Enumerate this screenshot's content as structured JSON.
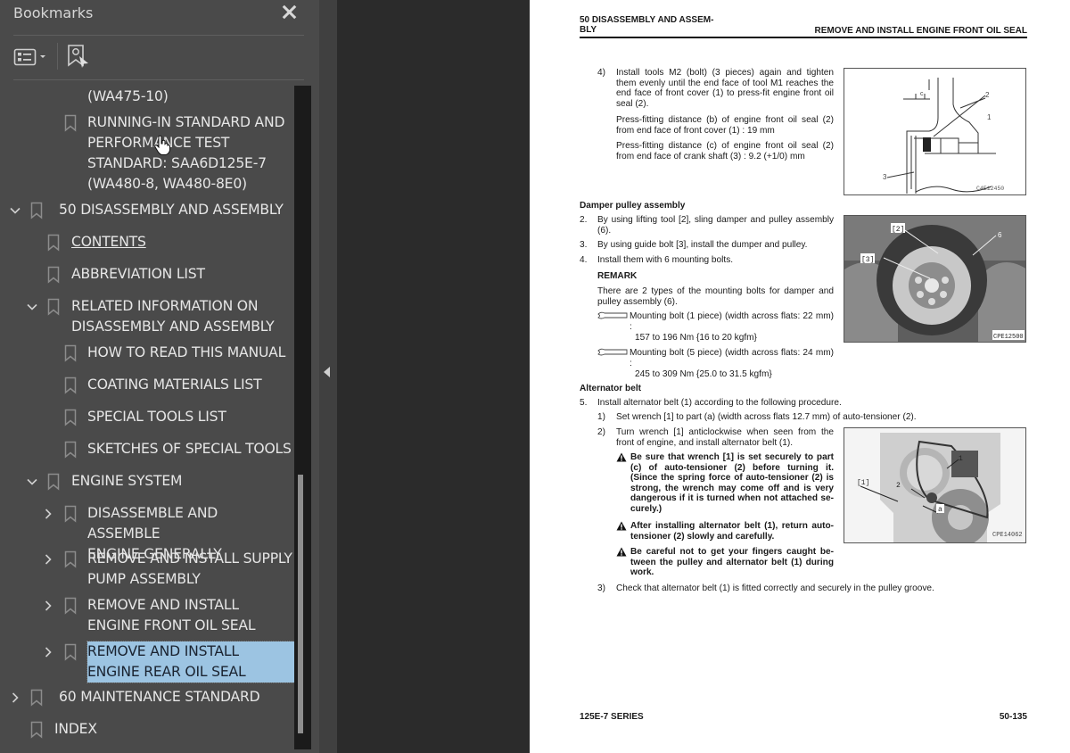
{
  "sidebar": {
    "title": "Bookmarks",
    "close_icon": "close-icon",
    "toolbar": {
      "options_icon": "list-options-icon",
      "find_icon": "find-bookmark-icon"
    },
    "items": [
      {
        "label": "(WA475-10)",
        "level": 2,
        "expander": "none",
        "has_bookmark_icon": false
      },
      {
        "label": " RUNNING-IN STANDARD AND\nPERFORMANCE TEST\nSTANDARD: SAA6D125E-7\n(WA480-8, WA480-8E0)",
        "level": 2,
        "expander": "none",
        "has_bookmark_icon": true
      },
      {
        "label": "50 DISASSEMBLY AND ASSEMBLY",
        "level": 0,
        "expander": "expanded",
        "has_bookmark_icon": true
      },
      {
        "label": " CONTENTS",
        "level": 1,
        "expander": "none",
        "has_bookmark_icon": true,
        "underlined": true
      },
      {
        "label": " ABBREVIATION LIST",
        "level": 1,
        "expander": "none",
        "has_bookmark_icon": true
      },
      {
        "label": " RELATED INFORMATION ON\nDISASSEMBLY AND ASSEMBLY",
        "level": 1,
        "expander": "expanded",
        "has_bookmark_icon": true
      },
      {
        "label": " HOW TO READ THIS MANUAL",
        "level": 2,
        "expander": "none",
        "has_bookmark_icon": true
      },
      {
        "label": " COATING MATERIALS LIST",
        "level": 2,
        "expander": "none",
        "has_bookmark_icon": true
      },
      {
        "label": " SPECIAL TOOLS LIST",
        "level": 2,
        "expander": "none",
        "has_bookmark_icon": true
      },
      {
        "label": " SKETCHES OF SPECIAL TOOLS",
        "level": 2,
        "expander": "none",
        "has_bookmark_icon": true
      },
      {
        "label": " ENGINE SYSTEM",
        "level": 1,
        "expander": "expanded",
        "has_bookmark_icon": true
      },
      {
        "label": " DISASSEMBLE AND ASSEMBLE\nENGINE GENERALLY",
        "level": 2,
        "expander": "collapsed",
        "has_bookmark_icon": true
      },
      {
        "label": " REMOVE AND INSTALL SUPPLY\nPUMP ASSEMBLY",
        "level": 2,
        "expander": "collapsed",
        "has_bookmark_icon": true
      },
      {
        "label": " REMOVE AND INSTALL\nENGINE FRONT OIL SEAL",
        "level": 2,
        "expander": "collapsed",
        "has_bookmark_icon": true
      },
      {
        "label": " REMOVE AND INSTALL\nENGINE REAR OIL SEAL",
        "level": 2,
        "expander": "collapsed",
        "has_bookmark_icon": true,
        "selected": true
      },
      {
        "label": "60 MAINTENANCE STANDARD",
        "level": 0,
        "expander": "collapsed",
        "has_bookmark_icon": true
      },
      {
        "label": "INDEX",
        "level": 0,
        "expander": "none",
        "has_bookmark_icon": true
      }
    ]
  },
  "colors": {
    "sidebar_bg": "#4a4a4a",
    "viewer_bg": "#2b2b2b",
    "selection": "#9cc4e2",
    "text": "#e6e6e6"
  },
  "page": {
    "header_left": "50 DISASSEMBLY AND ASSEM-\nBLY",
    "header_right": "REMOVE AND INSTALL ENGINE FRONT OIL SEAL",
    "step4_num": "4)",
    "step4_text": "Install tools M2 (bolt) (3 pieces) again and tighten them evenly until the end face of tool M1 reaches the end face of front cover (1) to press-fit engine front oil seal (2).",
    "step4_b": "Press-fitting distance (b) of engine front oil seal (2) from end face of front cover (1) : 19 mm",
    "step4_c": "Press-fitting distance (c) of engine front oil seal (2) from end face of crank shaft (3) : 9.2 (+1/0) mm",
    "fig1": {
      "code": "C4E12450",
      "labels": [
        "c",
        "2",
        "1",
        "3"
      ]
    },
    "damper_heading": "Damper pulley assembly",
    "damper_steps": [
      {
        "num": "2.",
        "text": "By using lifting tool [2], sling damper and pulley assembly (6)."
      },
      {
        "num": "3.",
        "text": "By using guide bolt [3], install the dumper and pulley."
      },
      {
        "num": "4.",
        "text": "Install them with 6 mounting bolts."
      }
    ],
    "remark_heading": "REMARK",
    "remark_text": "There are 2 types of the mounting bolts for damper and pulley assembly (6).",
    "torques": [
      {
        "icon": "torque-wrench-icon",
        "text": "Mounting bolt (1 piece) (width across flats: 22 mm) :",
        "value": "157 to 196 Nm {16 to 20 kgfm}"
      },
      {
        "icon": "torque-wrench-icon",
        "text": "Mounting bolt (5 piece) (width across flats: 24 mm) :",
        "value": "245 to 309 Nm {25.0 to 31.5 kgfm}"
      }
    ],
    "fig2": {
      "code": "CPE12500",
      "labels": [
        "[2]",
        "[3]",
        "6"
      ]
    },
    "alt_heading": "Alternator belt",
    "alt_step5_num": "5.",
    "alt_step5": "Install alternator belt (1) according to the following procedure.",
    "alt_sub1_num": "1)",
    "alt_sub1": "Set wrench [1] to part (a) (width across flats 12.7 mm) of auto-tensioner (2).",
    "alt_sub2_num": "2)",
    "alt_sub2": "Turn wrench [1] anticlockwise when seen from the front of engine, and install alternator belt (1).",
    "warnings": [
      "Be sure that wrench [1] is set securely to part (c) of auto-tensioner (2) before turning it. (Since the spring force of auto-tensioner (2) is strong, the wrench may come off and is very dangerous if it is turned when not attached se-curely.)",
      "After installing alternator belt (1), return auto-tensioner (2) slowly and carefully.",
      "Be careful not to get your fingers caught be-tween the pulley and alternator belt (1) during work."
    ],
    "alt_sub3_num": "3)",
    "alt_sub3": "Check that alternator belt (1) is fitted correctly and securely in the pulley groove.",
    "fig3": {
      "code": "CPE14062",
      "labels": [
        "[1]",
        "2",
        "1",
        "a"
      ]
    },
    "footer_left": "125E-7 SERIES",
    "footer_right": "50-135"
  }
}
